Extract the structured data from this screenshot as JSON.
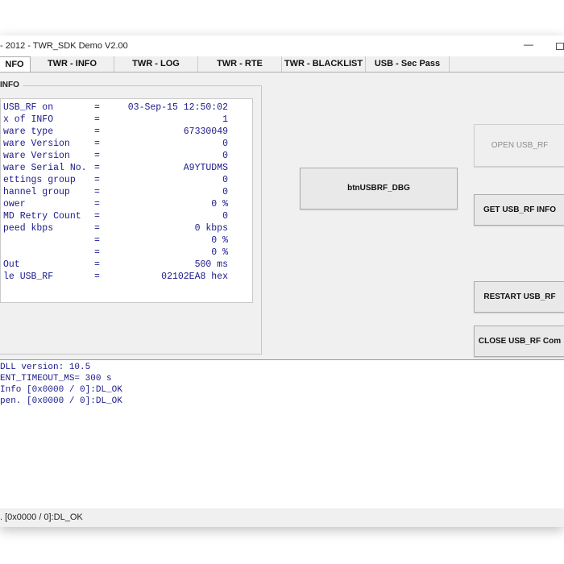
{
  "window": {
    "title": "- 2012  - TWR_SDK Demo V2.00",
    "minimize_glyph": "—"
  },
  "tabs": [
    {
      "label": "NFO",
      "active": true
    },
    {
      "label": "TWR - INFO",
      "active": false
    },
    {
      "label": "TWR - LOG",
      "active": false
    },
    {
      "label": "TWR - RTE",
      "active": false
    },
    {
      "label": "TWR - BLACKLIST",
      "active": false
    },
    {
      "label": "USB - Sec Pass",
      "active": false
    }
  ],
  "info_group": {
    "title": "INFO",
    "rows": [
      {
        "label": "USB_RF on",
        "eq": "=",
        "value": "03-Sep-15 12:50:02"
      },
      {
        "label": "x of INFO",
        "eq": "=",
        "value": "1"
      },
      {
        "label": "ware type",
        "eq": "=",
        "value": "67330049"
      },
      {
        "label": "ware Version",
        "eq": "=",
        "value": "0"
      },
      {
        "label": "ware Version",
        "eq": "=",
        "value": "0"
      },
      {
        "label": "ware Serial No.",
        "eq": "=",
        "value": "A9YTUDMS"
      },
      {
        "label": "ettings group",
        "eq": "=",
        "value": "0"
      },
      {
        "label": "hannel group",
        "eq": "=",
        "value": "0"
      },
      {
        "label": "ower",
        "eq": "=",
        "value": "0 %"
      },
      {
        "label": "MD Retry Count",
        "eq": "=",
        "value": "0"
      },
      {
        "label": "peed kbps",
        "eq": "=",
        "value": "0 kbps"
      },
      {
        "label": "",
        "eq": "=",
        "value": "0 %"
      },
      {
        "label": "",
        "eq": "=",
        "value": "0 %"
      },
      {
        "label": "Out",
        "eq": "=",
        "value": "500 ms"
      },
      {
        "label": "le USB_RF",
        "eq": "=",
        "value": "02102EA8 hex"
      }
    ]
  },
  "buttons": {
    "dbg": "btnUSBRF_DBG",
    "open": "OPEN USB_RF",
    "get_info": "GET USB_RF INFO",
    "restart": "RESTART USB_RF",
    "close": "CLOSE USB_RF Com"
  },
  "log": [
    " DLL version: 10.5",
    "ENT_TIMEOUT_MS= 300 s",
    "Info [0x0000 / 0]:DL_OK",
    "pen. [0x0000 / 0]:DL_OK"
  ],
  "status": {
    "text": ". [0x0000 / 0]:DL_OK"
  }
}
